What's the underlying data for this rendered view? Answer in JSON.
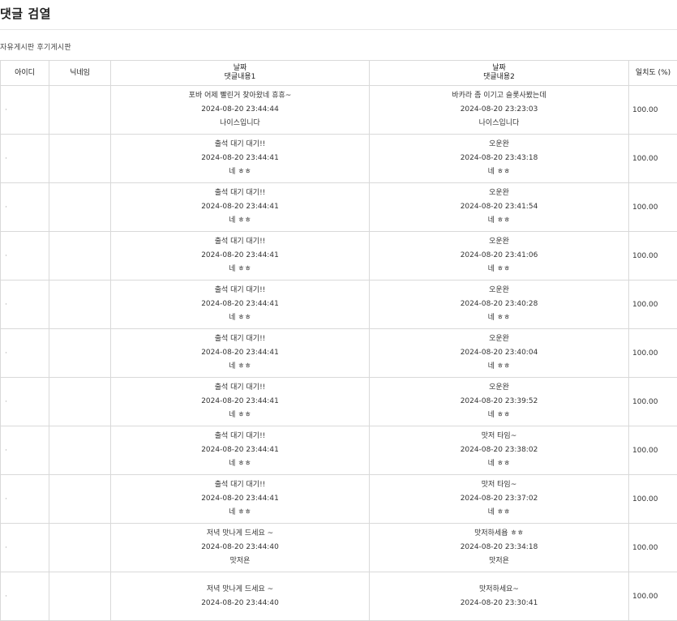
{
  "page": {
    "title": "댓글 검열"
  },
  "board_tabs": [
    "자유게시판",
    "후기게시판"
  ],
  "table": {
    "headers": {
      "id": "아이디",
      "nickname": "닉네임",
      "comment1_line1": "날짜",
      "comment1_line2": "댓글내용1",
      "comment2_line1": "날짜",
      "comment2_line2": "댓글내용2",
      "similarity": "일치도 (%)"
    },
    "rows": [
      {
        "id": "·",
        "c1": {
          "title": "포바 어제 빨린거 찾아왔네 휴휴~",
          "date": "2024-08-20 23:44:44",
          "body": "나이스입니다"
        },
        "c2": {
          "title": "바카라 좀 이기고 슬롯사봤는데",
          "date": "2024-08-20 23:23:03",
          "body": "나이스입니다"
        },
        "score": "100.00"
      },
      {
        "id": "·",
        "c1": {
          "title": "출석 대기 대기!!",
          "date": "2024-08-20 23:44:41",
          "body": "네 ㅎㅎ"
        },
        "c2": {
          "title": "오운완",
          "date": "2024-08-20 23:43:18",
          "body": "네 ㅎㅎ"
        },
        "score": "100.00"
      },
      {
        "id": "·",
        "c1": {
          "title": "출석 대기 대기!!",
          "date": "2024-08-20 23:44:41",
          "body": "네 ㅎㅎ"
        },
        "c2": {
          "title": "오운완",
          "date": "2024-08-20 23:41:54",
          "body": "네 ㅎㅎ"
        },
        "score": "100.00"
      },
      {
        "id": "·",
        "c1": {
          "title": "출석 대기 대기!!",
          "date": "2024-08-20 23:44:41",
          "body": "네 ㅎㅎ"
        },
        "c2": {
          "title": "오운완",
          "date": "2024-08-20 23:41:06",
          "body": "네 ㅎㅎ"
        },
        "score": "100.00"
      },
      {
        "id": "·",
        "c1": {
          "title": "출석 대기 대기!!",
          "date": "2024-08-20 23:44:41",
          "body": "네 ㅎㅎ"
        },
        "c2": {
          "title": "오운완",
          "date": "2024-08-20 23:40:28",
          "body": "네 ㅎㅎ"
        },
        "score": "100.00"
      },
      {
        "id": "·",
        "c1": {
          "title": "출석 대기 대기!!",
          "date": "2024-08-20 23:44:41",
          "body": "네 ㅎㅎ"
        },
        "c2": {
          "title": "오운완",
          "date": "2024-08-20 23:40:04",
          "body": "네 ㅎㅎ"
        },
        "score": "100.00"
      },
      {
        "id": "·",
        "c1": {
          "title": "출석 대기 대기!!",
          "date": "2024-08-20 23:44:41",
          "body": "네 ㅎㅎ"
        },
        "c2": {
          "title": "오운완",
          "date": "2024-08-20 23:39:52",
          "body": "네 ㅎㅎ"
        },
        "score": "100.00"
      },
      {
        "id": "·",
        "c1": {
          "title": "출석 대기 대기!!",
          "date": "2024-08-20 23:44:41",
          "body": "네 ㅎㅎ"
        },
        "c2": {
          "title": "맛저 타임~",
          "date": "2024-08-20 23:38:02",
          "body": "네 ㅎㅎ"
        },
        "score": "100.00"
      },
      {
        "id": "·",
        "c1": {
          "title": "출석 대기 대기!!",
          "date": "2024-08-20 23:44:41",
          "body": "네 ㅎㅎ"
        },
        "c2": {
          "title": "맛저 타임~",
          "date": "2024-08-20 23:37:02",
          "body": "네 ㅎㅎ"
        },
        "score": "100.00"
      },
      {
        "id": "·",
        "c1": {
          "title": "저녁 맛나게 드세요 ~",
          "date": "2024-08-20 23:44:40",
          "body": "맛저욘"
        },
        "c2": {
          "title": "맛저하세욥 ㅎㅎ",
          "date": "2024-08-20 23:34:18",
          "body": "맛저욘"
        },
        "score": "100.00"
      },
      {
        "id": "·",
        "c1": {
          "title": "저녁 맛나게 드세요 ~",
          "date": "2024-08-20 23:44:40",
          "body": ""
        },
        "c2": {
          "title": "맛저하세요~",
          "date": "2024-08-20 23:30:41",
          "body": ""
        },
        "score": "100.00"
      }
    ]
  }
}
